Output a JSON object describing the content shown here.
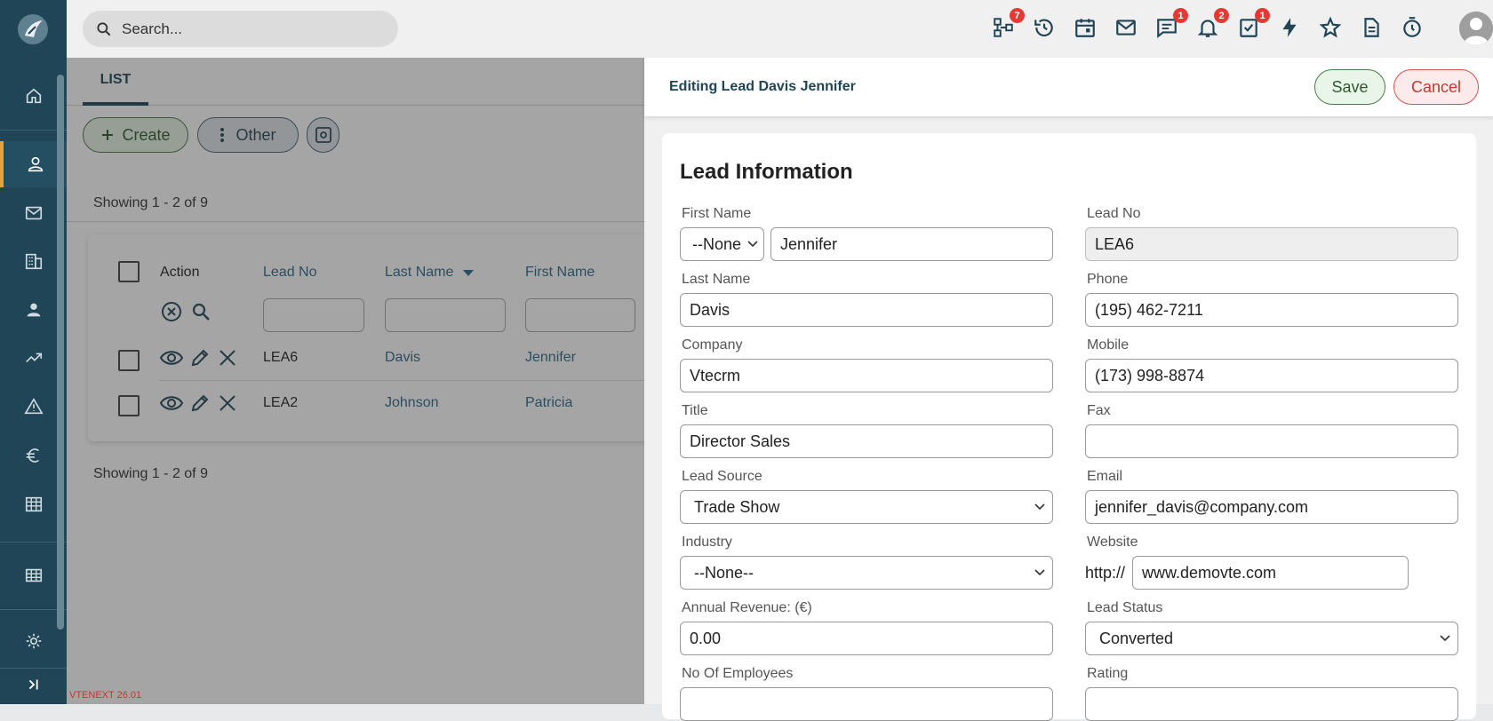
{
  "app": {
    "version": "VTENEXT 26.01"
  },
  "search": {
    "placeholder": "Search..."
  },
  "topbar": {
    "badges": {
      "processes": "7",
      "chat": "1",
      "notifications": "2",
      "tasks": "1"
    }
  },
  "list": {
    "tab": "LIST",
    "create_label": "Create",
    "other_label": "Other",
    "showing_top": "Showing 1 - 2 of 9",
    "showing_bottom": "Showing 1 - 2 of 9",
    "columns": {
      "action": "Action",
      "lead_no": "Lead No",
      "last_name": "Last Name",
      "first_name": "First Name"
    },
    "rows": [
      {
        "lead_no": "LEA6",
        "last_name": "Davis",
        "first_name": "Jennifer"
      },
      {
        "lead_no": "LEA2",
        "last_name": "Johnson",
        "first_name": "Patricia"
      }
    ]
  },
  "panel": {
    "title": "Editing Lead Davis Jennifer",
    "save": "Save",
    "cancel": "Cancel",
    "section": "Lead Information",
    "fields": {
      "first_name": {
        "label": "First Name",
        "salutation": "--None",
        "value": "Jennifer"
      },
      "lead_no": {
        "label": "Lead No",
        "value": "LEA6"
      },
      "last_name": {
        "label": "Last Name",
        "value": "Davis"
      },
      "phone": {
        "label": "Phone",
        "value": "(195) 462-7211"
      },
      "company": {
        "label": "Company",
        "value": "Vtecrm"
      },
      "mobile": {
        "label": "Mobile",
        "value": "(173) 998-8874"
      },
      "title": {
        "label": "Title",
        "value": "Director Sales"
      },
      "fax": {
        "label": "Fax",
        "value": ""
      },
      "lead_source": {
        "label": "Lead Source",
        "value": "Trade Show"
      },
      "email": {
        "label": "Email",
        "value": "jennifer_davis@company.com"
      },
      "industry": {
        "label": "Industry",
        "value": "--None--"
      },
      "website": {
        "label": "Website",
        "prefix": "http://",
        "value": "www.demovte.com"
      },
      "annual_revenue": {
        "label": "Annual Revenue: (€)",
        "value": "0.00"
      },
      "lead_status": {
        "label": "Lead Status",
        "value": "Converted"
      },
      "employees": {
        "label": "No Of Employees",
        "value": ""
      },
      "rating": {
        "label": "Rating",
        "value": ""
      }
    }
  }
}
